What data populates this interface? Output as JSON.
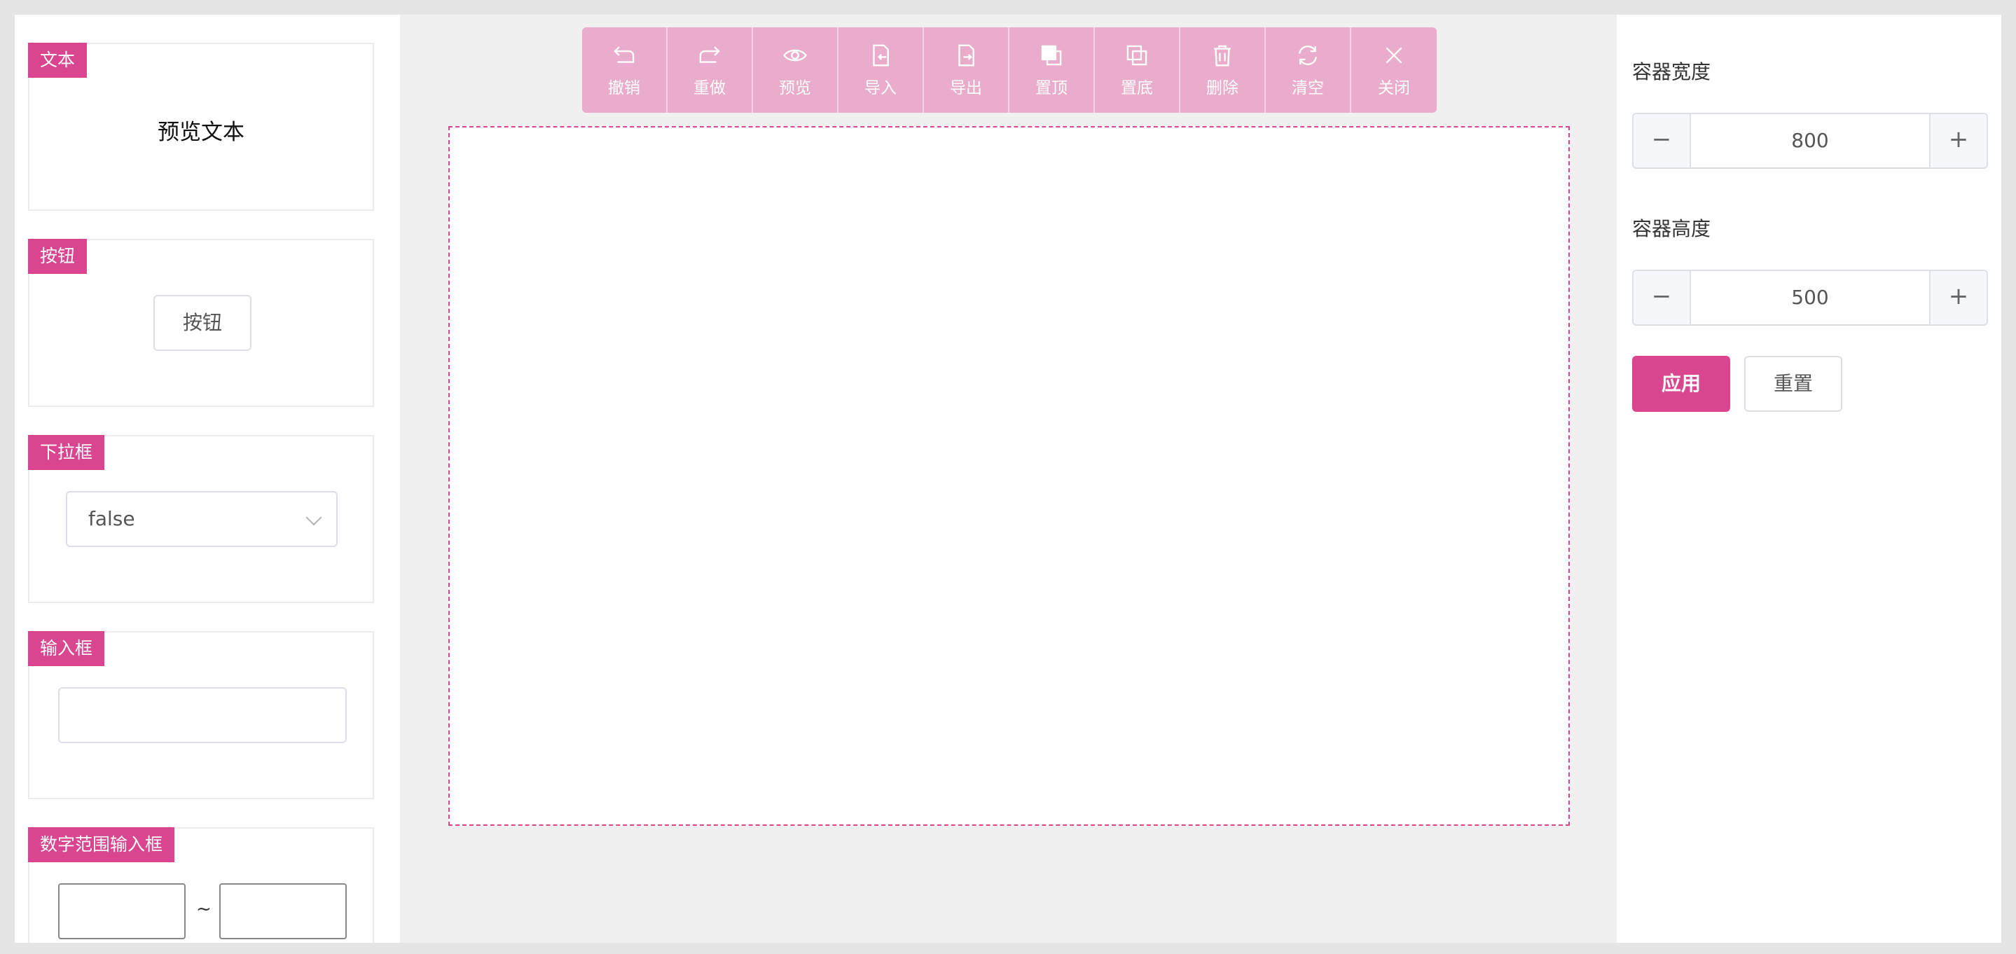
{
  "colors": {
    "accent": "#d9458f",
    "toolbar_bg": "#eaaccb",
    "canvas_border": "#d9458f"
  },
  "toolbar": {
    "items": [
      {
        "label": "撤销",
        "icon": "undo-icon"
      },
      {
        "label": "重做",
        "icon": "redo-icon"
      },
      {
        "label": "预览",
        "icon": "eye-icon"
      },
      {
        "label": "导入",
        "icon": "import-file-icon"
      },
      {
        "label": "导出",
        "icon": "export-file-icon"
      },
      {
        "label": "置顶",
        "icon": "bring-to-front-icon"
      },
      {
        "label": "置底",
        "icon": "send-to-back-icon"
      },
      {
        "label": "删除",
        "icon": "trash-icon"
      },
      {
        "label": "清空",
        "icon": "refresh-icon"
      },
      {
        "label": "关闭",
        "icon": "close-icon"
      }
    ]
  },
  "components": {
    "text": {
      "tag": "文本",
      "preview": "预览文本"
    },
    "button": {
      "tag": "按钮",
      "preview": "按钮"
    },
    "select": {
      "tag": "下拉框",
      "value": "false"
    },
    "input": {
      "tag": "输入框",
      "value": ""
    },
    "range": {
      "tag": "数字范围输入框",
      "separator": "~"
    }
  },
  "properties": {
    "width": {
      "label": "容器宽度",
      "value": "800",
      "minus": "−",
      "plus": "+"
    },
    "height": {
      "label": "容器高度",
      "value": "500",
      "minus": "−",
      "plus": "+"
    },
    "apply_label": "应用",
    "reset_label": "重置"
  }
}
